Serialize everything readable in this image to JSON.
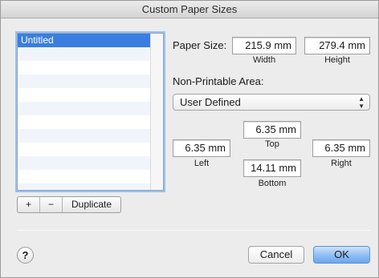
{
  "window": {
    "title": "Custom Paper Sizes"
  },
  "list": {
    "items": [
      "Untitled"
    ],
    "selected_index": 0
  },
  "list_controls": {
    "add": "+",
    "remove": "−",
    "duplicate": "Duplicate"
  },
  "paper_size": {
    "label": "Paper Size:",
    "width_value": "215.9 mm",
    "width_label": "Width",
    "height_value": "279.4 mm",
    "height_label": "Height"
  },
  "non_printable": {
    "label": "Non-Printable Area:",
    "selected": "User Defined",
    "top_value": "6.35 mm",
    "top_label": "Top",
    "left_value": "6.35 mm",
    "left_label": "Left",
    "right_value": "6.35 mm",
    "right_label": "Right",
    "bottom_value": "14.11 mm",
    "bottom_label": "Bottom"
  },
  "footer": {
    "help": "?",
    "cancel": "Cancel",
    "ok": "OK"
  },
  "colors": {
    "selection": "#3a7ee0",
    "default_button": "#8fbdf3"
  }
}
